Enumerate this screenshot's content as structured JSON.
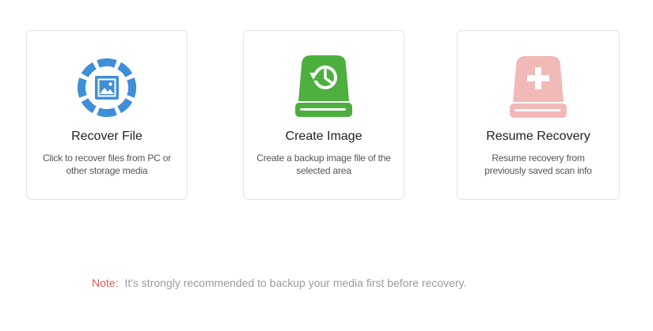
{
  "cards": [
    {
      "title": "Recover File",
      "desc_line1": "Click to recover files from PC or",
      "desc_line2": "other storage media",
      "icon": "recover-file-icon",
      "color": "#3f8ed8"
    },
    {
      "title": "Create Image",
      "desc_line1": "Create a backup image file of the",
      "desc_line2": "selected area",
      "icon": "create-image-icon",
      "color": "#4caf3e"
    },
    {
      "title": "Resume Recovery",
      "desc_line1": "Resume recovery from",
      "desc_line2": "previously saved scan info",
      "icon": "resume-recovery-icon",
      "color": "#f2b9b9"
    }
  ],
  "note": {
    "label": "Note:",
    "text": "It's strongly recommended to backup your media first before recovery.",
    "label_color": "#e05a4e"
  }
}
